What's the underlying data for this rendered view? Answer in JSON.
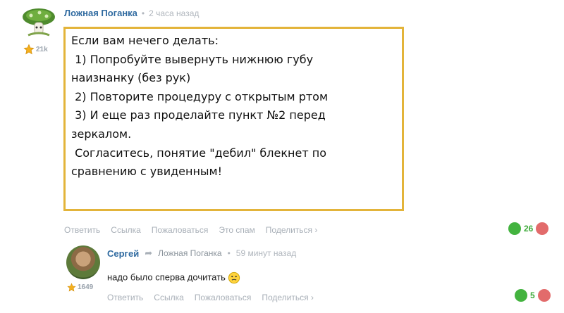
{
  "comment": {
    "author": "Ложная Поганка",
    "time": "2 часа назад",
    "rating": "21k",
    "body_lines": [
      "Если вам нечего делать:",
      " 1) Попробуйте вывернуть нижнюю губу",
      "наизнанку (без рук)",
      " 2) Повторите процедуру с открытым ртом",
      " 3) И еще раз проделайте пункт №2 перед",
      "зеркалом.",
      " Согласитесь, понятие \"дебил\" блекнет по",
      "сравнению с увиденным!"
    ],
    "actions": [
      "Ответить",
      "Ссылка",
      "Пожаловаться",
      "Это спам",
      "Поделиться ›"
    ],
    "votes": "26"
  },
  "reply": {
    "author": "Сергей",
    "reply_to": "Ложная Поганка",
    "time": "59 минут назад",
    "rating": "1649",
    "text": "надо было сперва дочитать",
    "actions": [
      "Ответить",
      "Ссылка",
      "Пожаловаться",
      "Поделиться ›"
    ],
    "votes": "5"
  },
  "colors": {
    "author": "#2f6aa0",
    "frame": "#e3b43a",
    "vote_up": "#43b33f",
    "vote_down": "#e26b6b"
  }
}
